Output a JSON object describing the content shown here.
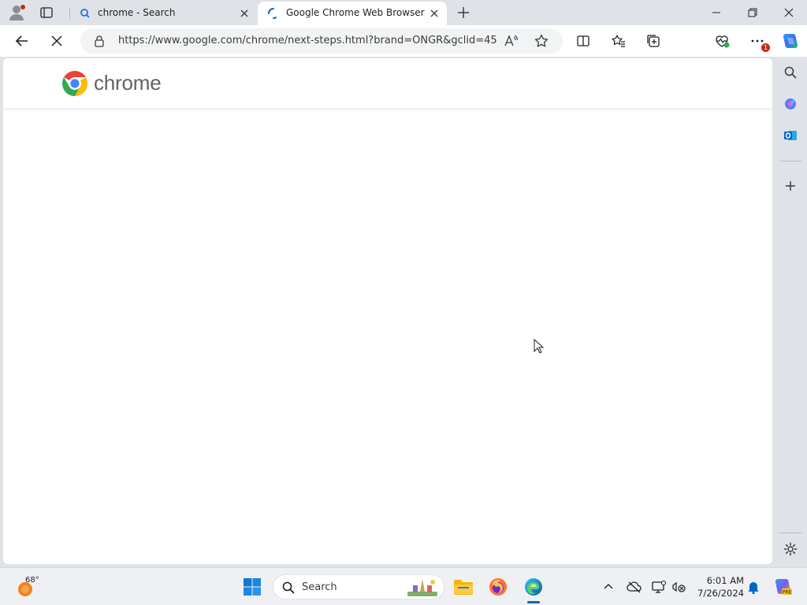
{
  "browser": {
    "tabs": [
      {
        "title": "chrome - Search",
        "favicon": "search-favicon"
      },
      {
        "title": "Google Chrome Web Browser",
        "favicon": "loading-favicon",
        "active": true
      }
    ],
    "url": "https://www.google.com/chrome/next-steps.html?brand=ONGR&gclid=45...",
    "extensions_badge": "1",
    "colors": {
      "accent": "#0067c0",
      "chrome_red": "#ea4335",
      "chrome_green": "#34a853",
      "chrome_yellow": "#fbbc04",
      "chrome_blue": "#4285f4"
    }
  },
  "page": {
    "brand_word": "chrome"
  },
  "sidebar": {
    "icons": [
      "search-icon",
      "copilot-icon",
      "outlook-icon",
      "add-icon",
      "settings-icon"
    ]
  },
  "taskbar": {
    "weather_temp": "68°",
    "search_label": "Search",
    "time": "6:01 AM",
    "date": "7/26/2024",
    "pinned": [
      "start-icon",
      "search-box",
      "file-explorer-icon",
      "firefox-icon",
      "edge-icon"
    ]
  }
}
